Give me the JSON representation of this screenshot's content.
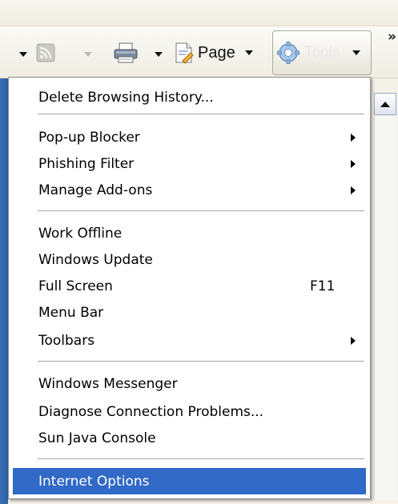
{
  "toolbar": {
    "page_label": "Page",
    "tools_label": "Tools",
    "overflow_label": "»"
  },
  "menu": {
    "items": [
      {
        "label": "Delete Browsing History...",
        "shortcut": "",
        "submenu": false,
        "selected": false
      },
      {
        "label": "Pop-up Blocker",
        "shortcut": "",
        "submenu": true,
        "selected": false
      },
      {
        "label": "Phishing Filter",
        "shortcut": "",
        "submenu": true,
        "selected": false
      },
      {
        "label": "Manage Add-ons",
        "shortcut": "",
        "submenu": true,
        "selected": false
      },
      {
        "label": "Work Offline",
        "shortcut": "",
        "submenu": false,
        "selected": false
      },
      {
        "label": "Windows Update",
        "shortcut": "",
        "submenu": false,
        "selected": false
      },
      {
        "label": "Full Screen",
        "shortcut": "F11",
        "submenu": false,
        "selected": false
      },
      {
        "label": "Menu Bar",
        "shortcut": "",
        "submenu": false,
        "selected": false
      },
      {
        "label": "Toolbars",
        "shortcut": "",
        "submenu": true,
        "selected": false
      },
      {
        "label": "Windows Messenger",
        "shortcut": "",
        "submenu": false,
        "selected": false
      },
      {
        "label": "Diagnose Connection Problems...",
        "shortcut": "",
        "submenu": false,
        "selected": false
      },
      {
        "label": "Sun Java Console",
        "shortcut": "",
        "submenu": false,
        "selected": false
      },
      {
        "label": "Internet Options",
        "shortcut": "",
        "submenu": false,
        "selected": true
      }
    ]
  },
  "icons": {
    "toolbar": [
      "chevron-down-icon",
      "rss-feed-icon",
      "print-icon",
      "page-icon",
      "gear-icon",
      "scroll-up-arrow-icon",
      "submenu-arrow-icon"
    ]
  },
  "colors": {
    "selection": "#3169c6",
    "menu_background": "#ffffff",
    "toolbar_background": "#f3f1e8",
    "left_pane": "#3c6fb4"
  }
}
